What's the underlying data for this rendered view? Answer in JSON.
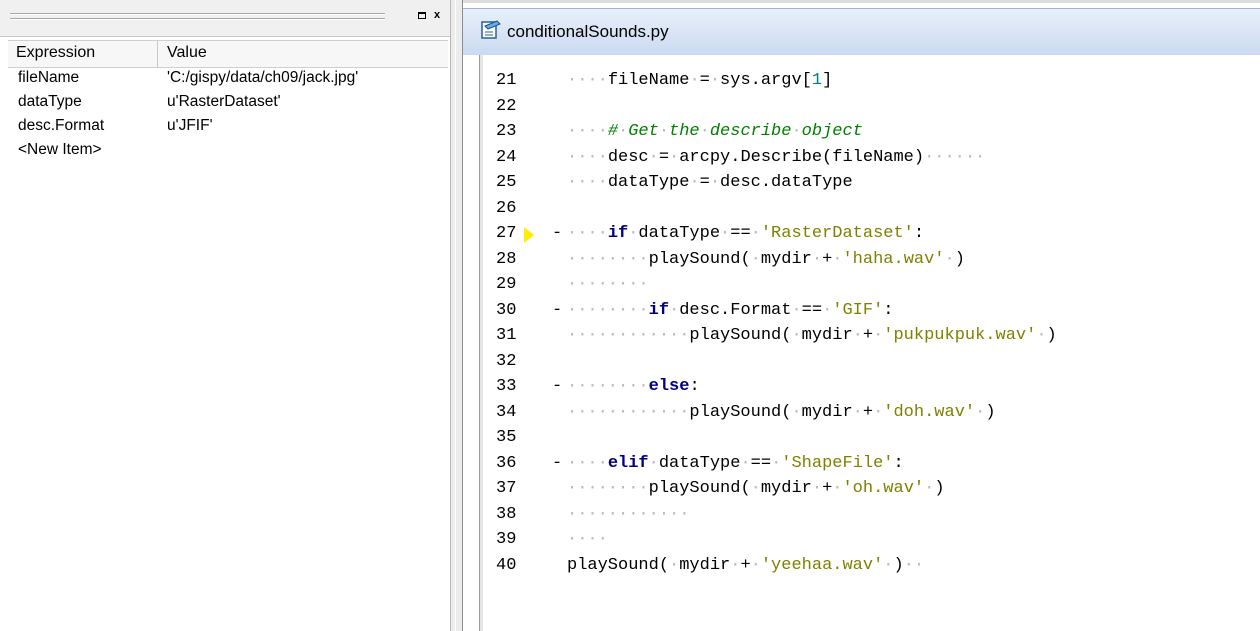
{
  "watch": {
    "headers": {
      "expression": "Expression",
      "value": "Value"
    },
    "rows": [
      {
        "expr": "fileName",
        "value": "'C:/gispy/data/ch09/jack.jpg'"
      },
      {
        "expr": "dataType",
        "value": "u'RasterDataset'"
      },
      {
        "expr": "desc.Format",
        "value": "u'JFIF'"
      },
      {
        "expr": "<New Item>",
        "value": ""
      }
    ],
    "buttons": {
      "restore_icon": "restore-icon",
      "close_icon": "close-icon",
      "close_glyph": "x"
    }
  },
  "editor": {
    "title": "conditionalSounds.py",
    "file_icon": "python-file-icon",
    "colors": {
      "keyword": "#000080",
      "string": "#808000",
      "comment": "#008000",
      "number": "#008080",
      "whitespace_dots": "#b8b8b8",
      "breakpoint_arrow": "#ffee00"
    },
    "current_line": 27,
    "lines": [
      {
        "n": "21",
        "fold": "",
        "indent": 4,
        "tokens": [
          [
            "t",
            "fileName"
          ],
          [
            "d",
            " "
          ],
          [
            "t",
            "="
          ],
          [
            "d",
            " "
          ],
          [
            "t",
            "sys.argv["
          ],
          [
            "num",
            "1"
          ],
          [
            "t",
            "]"
          ]
        ]
      },
      {
        "n": "22",
        "fold": "",
        "indent": 0,
        "tokens": []
      },
      {
        "n": "23",
        "fold": "",
        "indent": 4,
        "tokens": [
          [
            "cm",
            "#"
          ],
          [
            "d",
            " "
          ],
          [
            "cm",
            "Get"
          ],
          [
            "d",
            " "
          ],
          [
            "cm",
            "the"
          ],
          [
            "d",
            " "
          ],
          [
            "cm",
            "describe"
          ],
          [
            "d",
            " "
          ],
          [
            "cm",
            "object"
          ]
        ]
      },
      {
        "n": "24",
        "fold": "",
        "indent": 4,
        "tokens": [
          [
            "t",
            "desc"
          ],
          [
            "d",
            " "
          ],
          [
            "t",
            "="
          ],
          [
            "d",
            " "
          ],
          [
            "t",
            "arcpy.Describe(fileName)"
          ],
          [
            "d",
            "      "
          ]
        ]
      },
      {
        "n": "25",
        "fold": "",
        "indent": 4,
        "tokens": [
          [
            "t",
            "dataType"
          ],
          [
            "d",
            " "
          ],
          [
            "t",
            "="
          ],
          [
            "d",
            " "
          ],
          [
            "t",
            "desc.dataType"
          ]
        ]
      },
      {
        "n": "26",
        "fold": "",
        "indent": 0,
        "tokens": []
      },
      {
        "n": "27",
        "fold": "-",
        "indent": 4,
        "tokens": [
          [
            "kw",
            "if"
          ],
          [
            "d",
            " "
          ],
          [
            "t",
            "dataType"
          ],
          [
            "d",
            " "
          ],
          [
            "t",
            "=="
          ],
          [
            "d",
            " "
          ],
          [
            "str",
            "'RasterDataset'"
          ],
          [
            "t",
            ":"
          ]
        ]
      },
      {
        "n": "28",
        "fold": "",
        "indent": 8,
        "tokens": [
          [
            "t",
            "playSound("
          ],
          [
            "d",
            " "
          ],
          [
            "t",
            "mydir"
          ],
          [
            "d",
            " "
          ],
          [
            "t",
            "+"
          ],
          [
            "d",
            " "
          ],
          [
            "str",
            "'haha.wav'"
          ],
          [
            "d",
            " "
          ],
          [
            "t",
            ")"
          ]
        ]
      },
      {
        "n": "29",
        "fold": "",
        "indent": 8,
        "tokens": []
      },
      {
        "n": "30",
        "fold": "-",
        "indent": 8,
        "tokens": [
          [
            "kw",
            "if"
          ],
          [
            "d",
            " "
          ],
          [
            "t",
            "desc.Format"
          ],
          [
            "d",
            " "
          ],
          [
            "t",
            "=="
          ],
          [
            "d",
            " "
          ],
          [
            "str",
            "'GIF'"
          ],
          [
            "t",
            ":"
          ]
        ]
      },
      {
        "n": "31",
        "fold": "",
        "indent": 12,
        "tokens": [
          [
            "t",
            "playSound("
          ],
          [
            "d",
            " "
          ],
          [
            "t",
            "mydir"
          ],
          [
            "d",
            " "
          ],
          [
            "t",
            "+"
          ],
          [
            "d",
            " "
          ],
          [
            "str",
            "'pukpukpuk.wav'"
          ],
          [
            "d",
            " "
          ],
          [
            "t",
            ")"
          ]
        ]
      },
      {
        "n": "32",
        "fold": "",
        "indent": 0,
        "tokens": []
      },
      {
        "n": "33",
        "fold": "-",
        "indent": 8,
        "tokens": [
          [
            "kw",
            "else"
          ],
          [
            "t",
            ":"
          ]
        ]
      },
      {
        "n": "34",
        "fold": "",
        "indent": 12,
        "tokens": [
          [
            "t",
            "playSound("
          ],
          [
            "d",
            " "
          ],
          [
            "t",
            "mydir"
          ],
          [
            "d",
            " "
          ],
          [
            "t",
            "+"
          ],
          [
            "d",
            " "
          ],
          [
            "str",
            "'doh.wav'"
          ],
          [
            "d",
            " "
          ],
          [
            "t",
            ")"
          ]
        ]
      },
      {
        "n": "35",
        "fold": "",
        "indent": 0,
        "tokens": []
      },
      {
        "n": "36",
        "fold": "-",
        "indent": 4,
        "tokens": [
          [
            "kw",
            "elif"
          ],
          [
            "d",
            " "
          ],
          [
            "t",
            "dataType"
          ],
          [
            "d",
            " "
          ],
          [
            "t",
            "=="
          ],
          [
            "d",
            " "
          ],
          [
            "str",
            "'ShapeFile'"
          ],
          [
            "t",
            ":"
          ]
        ]
      },
      {
        "n": "37",
        "fold": "",
        "indent": 8,
        "tokens": [
          [
            "t",
            "playSound("
          ],
          [
            "d",
            " "
          ],
          [
            "t",
            "mydir"
          ],
          [
            "d",
            " "
          ],
          [
            "t",
            "+"
          ],
          [
            "d",
            " "
          ],
          [
            "str",
            "'oh.wav'"
          ],
          [
            "d",
            " "
          ],
          [
            "t",
            ")"
          ]
        ]
      },
      {
        "n": "38",
        "fold": "",
        "indent": 12,
        "tokens": []
      },
      {
        "n": "39",
        "fold": "",
        "indent": 4,
        "tokens": []
      },
      {
        "n": "40",
        "fold": "",
        "indent": 0,
        "tokens": [
          [
            "t",
            "playSound("
          ],
          [
            "d",
            " "
          ],
          [
            "t",
            "mydir"
          ],
          [
            "d",
            " "
          ],
          [
            "t",
            "+"
          ],
          [
            "d",
            " "
          ],
          [
            "str",
            "'yeehaa.wav'"
          ],
          [
            "d",
            " "
          ],
          [
            "t",
            ")"
          ],
          [
            "d",
            "  "
          ]
        ]
      }
    ]
  }
}
